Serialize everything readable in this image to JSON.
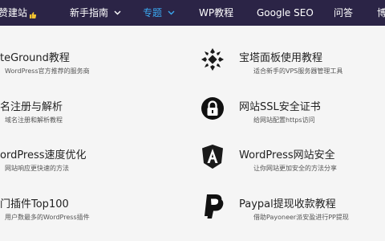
{
  "nav": {
    "items": [
      {
        "label": "赞建站",
        "active": false
      },
      {
        "label": "新手指南",
        "active": false
      },
      {
        "label": "专题",
        "active": true
      },
      {
        "label": "WP教程",
        "active": false
      },
      {
        "label": "Google SEO",
        "active": false
      },
      {
        "label": "问答",
        "active": false
      },
      {
        "label": "博",
        "active": false
      }
    ]
  },
  "left_column": [
    {
      "title": "teGround教程",
      "desc": "WordPress官方推荐的服务商"
    },
    {
      "title": "名注册与解析",
      "desc": "域名注册和解析教程"
    },
    {
      "title": "ordPress速度优化",
      "desc": "网站响应更快速的方法"
    },
    {
      "title": "门插件Top100",
      "desc": "用户数最多的WordPress插件"
    }
  ],
  "right_column": [
    {
      "title": "宝塔面板使用教程",
      "desc": "适合新手的VPS服务器管理工具",
      "icon": "baota-logo-icon"
    },
    {
      "title": "网站SSL安全证书",
      "desc": "给网站配置https访问",
      "icon": "padlock-icon"
    },
    {
      "title": "WordPress网站安全",
      "desc": "让你网站更加安全的方法分享",
      "icon": "shield-a-icon"
    },
    {
      "title": "Paypal提现收款教程",
      "desc": "借助Payoneer派安盈进行PP提现",
      "icon": "paypal-icon"
    }
  ],
  "colors": {
    "nav_bg": "#2b2446",
    "active": "#3aa8f0",
    "panel_bg": "#f5f5f5"
  }
}
